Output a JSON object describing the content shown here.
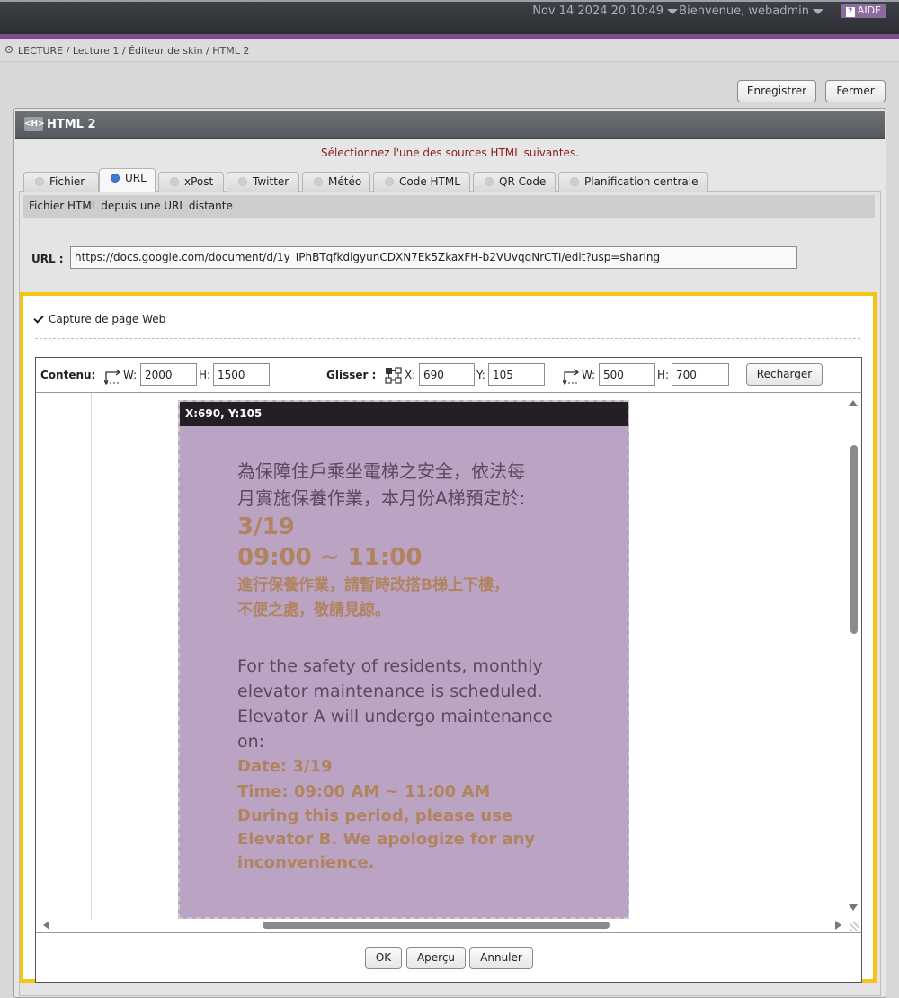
{
  "topbar": {
    "datetime": "Nov 14 2024 20:10:49",
    "welcome": "Bienvenue, webadmin",
    "help": "AIDE"
  },
  "breadcrumb": "LECTURE / Lecture 1 / Éditeur de skin / HTML 2",
  "actions": {
    "save": "Enregistrer",
    "close": "Fermer"
  },
  "panel": {
    "icon": "<H>",
    "title": "HTML 2",
    "select_message": "Sélectionnez l'une des sources HTML suivantes.",
    "tabs": [
      {
        "label": "Fichier",
        "active": false
      },
      {
        "label": "URL",
        "active": true
      },
      {
        "label": "xPost",
        "active": false
      },
      {
        "label": "Twitter",
        "active": false
      },
      {
        "label": "Météo",
        "active": false
      },
      {
        "label": "Code HTML",
        "active": false
      },
      {
        "label": "QR Code",
        "active": false
      },
      {
        "label": "Planification centrale",
        "active": false
      }
    ],
    "source_desc": "Fichier HTML depuis une URL distante",
    "url_label": "URL :",
    "url_value": "https://docs.google.com/document/d/1y_IPhBTqfkdigyunCDXN7Ek5ZkaxFH-b2VUvqqNrCTI/edit?usp=sharing"
  },
  "capture": {
    "label": "Capture de page Web",
    "toolbar": {
      "content_label": "Contenu:",
      "content_w_label": "W:",
      "content_w": "2000",
      "content_h_label": "H:",
      "content_h": "1500",
      "drag_label": "Glisser :",
      "drag_x_label": "X:",
      "drag_x": "690",
      "drag_y_label": "Y:",
      "drag_y": "105",
      "drag_w_label": "W:",
      "drag_w": "500",
      "drag_h_label": "H:",
      "drag_h": "700",
      "reload": "Recharger"
    },
    "drag_title": "X:690, Y:105",
    "notice": {
      "zh_line1": "為保障住戶乘坐電梯之安全，依法每",
      "zh_line2": "月實施保養作業，本月份A梯預定於:",
      "date": "3/19",
      "time": "09:00 ~ 11:00",
      "zh_strong1": "進行保養作業，請暫時改搭B梯上下樓，",
      "zh_strong2": "不便之處，敬請見諒。",
      "en_line1": "For the safety of residents, monthly",
      "en_line2": "elevator maintenance is scheduled.",
      "en_line3": "Elevator A will undergo maintenance",
      "en_line4": "on:",
      "en_date": "Date: 3/19",
      "en_time": "Time: 09:00 AM ~ 11:00 AM",
      "en_strong1": "During this period, please use",
      "en_strong2": "Elevator B. We apologize for any",
      "en_strong3": "inconvenience."
    },
    "footer": {
      "ok": "OK",
      "preview": "Aperçu",
      "cancel": "Annuler"
    }
  },
  "colors": {
    "accent_purple": "#7d4e8c",
    "highlight_yellow": "#f5c415",
    "notice_bg": "#bba3c3",
    "notice_accent": "#b08460"
  }
}
